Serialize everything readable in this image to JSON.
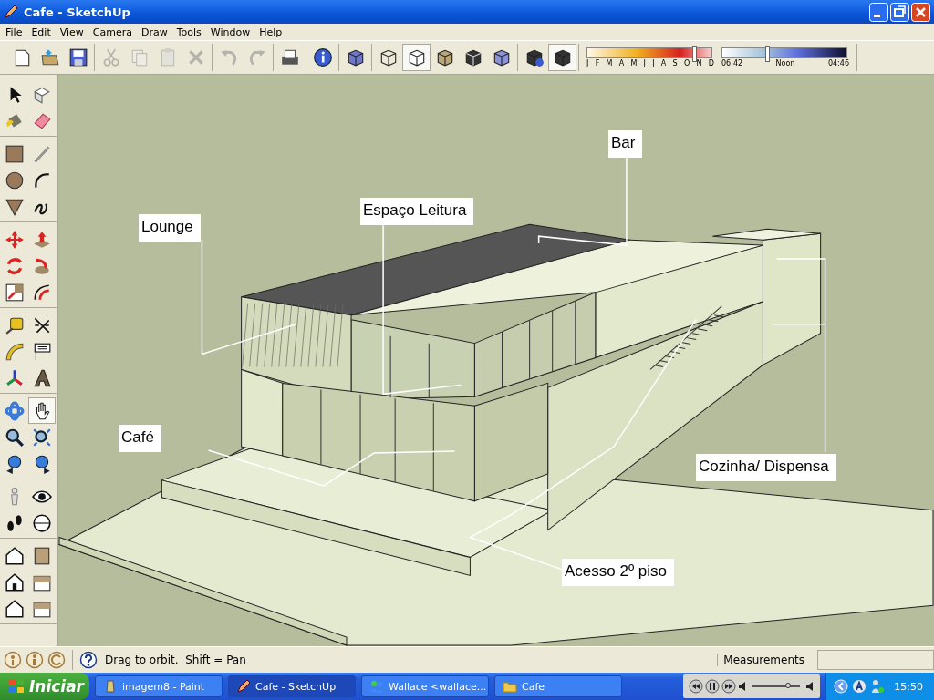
{
  "window": {
    "title": "Cafe - SketchUp"
  },
  "menu": [
    "File",
    "Edit",
    "View",
    "Camera",
    "Draw",
    "Tools",
    "Window",
    "Help"
  ],
  "toolbar": [
    [
      {
        "kind": "new",
        "disabled": false,
        "pressed": false
      },
      {
        "kind": "open",
        "disabled": false,
        "pressed": false
      },
      {
        "kind": "save",
        "disabled": false,
        "pressed": false
      }
    ],
    [
      {
        "kind": "cut",
        "disabled": true,
        "pressed": false
      },
      {
        "kind": "copy",
        "disabled": true,
        "pressed": false
      },
      {
        "kind": "paste",
        "disabled": true,
        "pressed": false
      },
      {
        "kind": "erase",
        "disabled": true,
        "pressed": false
      }
    ],
    [
      {
        "kind": "undo",
        "disabled": true,
        "pressed": false
      },
      {
        "kind": "redo",
        "disabled": true,
        "pressed": false
      }
    ],
    [
      {
        "kind": "print",
        "disabled": false,
        "pressed": false
      }
    ],
    [
      {
        "kind": "info",
        "disabled": false,
        "pressed": false
      }
    ],
    [
      {
        "kind": "xray",
        "disabled": false,
        "pressed": false
      }
    ],
    [
      {
        "kind": "wireframe",
        "disabled": false,
        "pressed": false
      },
      {
        "kind": "hiddenline",
        "disabled": false,
        "pressed": true
      },
      {
        "kind": "shaded",
        "disabled": false,
        "pressed": false
      },
      {
        "kind": "textured",
        "disabled": false,
        "pressed": false
      },
      {
        "kind": "monochrome",
        "disabled": false,
        "pressed": false
      }
    ],
    [
      {
        "kind": "shadowinfo",
        "disabled": false,
        "pressed": false
      },
      {
        "kind": "shadows",
        "disabled": false,
        "pressed": true
      }
    ]
  ],
  "date_slider": {
    "level": 0.86,
    "months": [
      "J",
      "F",
      "M",
      "A",
      "M",
      "J",
      "J",
      "A",
      "S",
      "O",
      "N",
      "D"
    ]
  },
  "time_slider": {
    "level": 0.36,
    "start": "06:42",
    "middle": "Noon",
    "end": "04:46"
  },
  "tools": [
    [
      {
        "kind": "select",
        "selected": false
      },
      {
        "kind": "component",
        "selected": false
      },
      {
        "kind": "paint",
        "selected": false
      },
      {
        "kind": "eraser",
        "selected": false
      }
    ],
    [
      {
        "kind": "rectangle",
        "selected": false
      },
      {
        "kind": "line",
        "selected": false
      },
      {
        "kind": "circle",
        "selected": false
      },
      {
        "kind": "arc",
        "selected": false
      },
      {
        "kind": "polygon",
        "selected": false
      },
      {
        "kind": "freehand",
        "selected": false
      }
    ],
    [
      {
        "kind": "move",
        "selected": false
      },
      {
        "kind": "pushpull",
        "selected": false
      },
      {
        "kind": "rotate",
        "selected": false
      },
      {
        "kind": "followme",
        "selected": false
      },
      {
        "kind": "scale",
        "selected": false
      },
      {
        "kind": "offset",
        "selected": false
      }
    ],
    [
      {
        "kind": "tape",
        "selected": false
      },
      {
        "kind": "dimension",
        "selected": false
      },
      {
        "kind": "protractor",
        "selected": false
      },
      {
        "kind": "text",
        "selected": false
      },
      {
        "kind": "axes",
        "selected": false
      },
      {
        "kind": "text3d",
        "selected": false
      }
    ],
    [
      {
        "kind": "orbit",
        "selected": false
      },
      {
        "kind": "pan",
        "selected": true
      },
      {
        "kind": "zoom",
        "selected": false
      },
      {
        "kind": "zoomwindow",
        "selected": false
      },
      {
        "kind": "previous",
        "selected": false
      },
      {
        "kind": "next",
        "selected": false
      }
    ],
    [
      {
        "kind": "walk",
        "selected": false
      },
      {
        "kind": "look",
        "selected": false
      },
      {
        "kind": "position",
        "selected": false
      },
      {
        "kind": "section",
        "selected": false
      }
    ],
    [
      {
        "kind": "iso",
        "selected": false
      },
      {
        "kind": "right",
        "selected": false
      },
      {
        "kind": "front",
        "selected": false
      },
      {
        "kind": "top",
        "selected": false
      },
      {
        "kind": "back",
        "selected": false
      },
      {
        "kind": "bottom",
        "selected": false
      }
    ]
  ],
  "callouts": [
    {
      "label": "Bar"
    },
    {
      "label": "Espaço Leitura"
    },
    {
      "label": "Lounge"
    },
    {
      "label": "Café"
    },
    {
      "label": "Cozinha/ Dispensa"
    },
    {
      "label": "Acesso 2º piso"
    }
  ],
  "status_bar": {
    "hint": "Drag to orbit.  Shift = Pan",
    "measurements_label": "Measurements"
  },
  "taskbar": {
    "start": "Iniciar",
    "tasks": [
      {
        "label": "imagem8 - Paint",
        "kind": "paint",
        "selected": false
      },
      {
        "label": "Cafe - SketchUp",
        "kind": "sketchup",
        "selected": true
      },
      {
        "label": "Wallace <wallace...",
        "kind": "messenger",
        "selected": false
      },
      {
        "label": "Cafe",
        "kind": "folder",
        "selected": false
      }
    ],
    "clock": "15:50",
    "volume": {
      "level": 0.75
    }
  }
}
